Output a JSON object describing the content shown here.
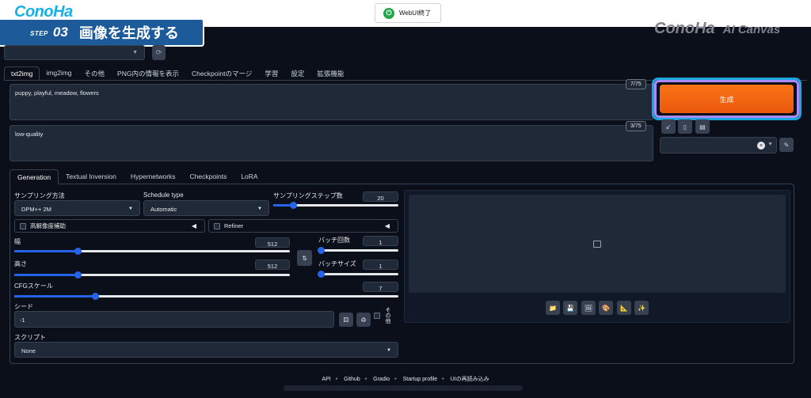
{
  "brand_top": "ConoHa",
  "webui_button": {
    "label": "WebUI終了",
    "icon": "power-icon"
  },
  "step_banner": {
    "step_word": "STEP",
    "step_num": "03",
    "title": "画像を生成する"
  },
  "brand_right": {
    "logo": "ConoHa",
    "product": "AI Canvas"
  },
  "main_tabs": [
    "txt2img",
    "img2img",
    "その他",
    "PNG内の情報を表示",
    "Checkpointのマージ",
    "学習",
    "設定",
    "拡張機能"
  ],
  "prompt": {
    "value": "puppy, playful, meadow, flowers",
    "token_count": "7/75"
  },
  "negative_prompt": {
    "value": "low-quality",
    "token_count": "3/75"
  },
  "generate_button": "生成",
  "sub_tabs": [
    "Generation",
    "Textual Inversion",
    "Hypernetworks",
    "Checkpoints",
    "LoRA"
  ],
  "sampling_method": {
    "label": "サンプリング方法",
    "value": "DPM++ 2M"
  },
  "schedule_type": {
    "label": "Schedule type",
    "value": "Automatic"
  },
  "sampling_steps": {
    "label": "サンプリングステップ数",
    "value": "20",
    "fraction": 0.16
  },
  "hires_fix": {
    "label": "高解像度補助"
  },
  "refiner": {
    "label": "Refiner"
  },
  "width": {
    "label": "幅",
    "value": "512",
    "fraction": 0.23
  },
  "height": {
    "label": "高さ",
    "value": "512",
    "fraction": 0.23
  },
  "batch_count": {
    "label": "バッチ回数",
    "value": "1",
    "fraction": 0.0
  },
  "batch_size": {
    "label": "バッチサイズ",
    "value": "1",
    "fraction": 0.0
  },
  "cfg_scale": {
    "label": "CFGスケール",
    "value": "7",
    "fraction": 0.21
  },
  "seed": {
    "label": "シード",
    "value": "-1",
    "extra_label": "その他"
  },
  "script": {
    "label": "スクリプト",
    "value": "None"
  },
  "footer": {
    "links": [
      "API",
      "Github",
      "Gradio",
      "Startup profile",
      "UIの再読み込み"
    ]
  },
  "colors": {
    "accent": "#2563eb",
    "generate": "#ea580c",
    "highlight_outer": "#1aa6e0",
    "highlight_inner": "#a78bfa"
  }
}
